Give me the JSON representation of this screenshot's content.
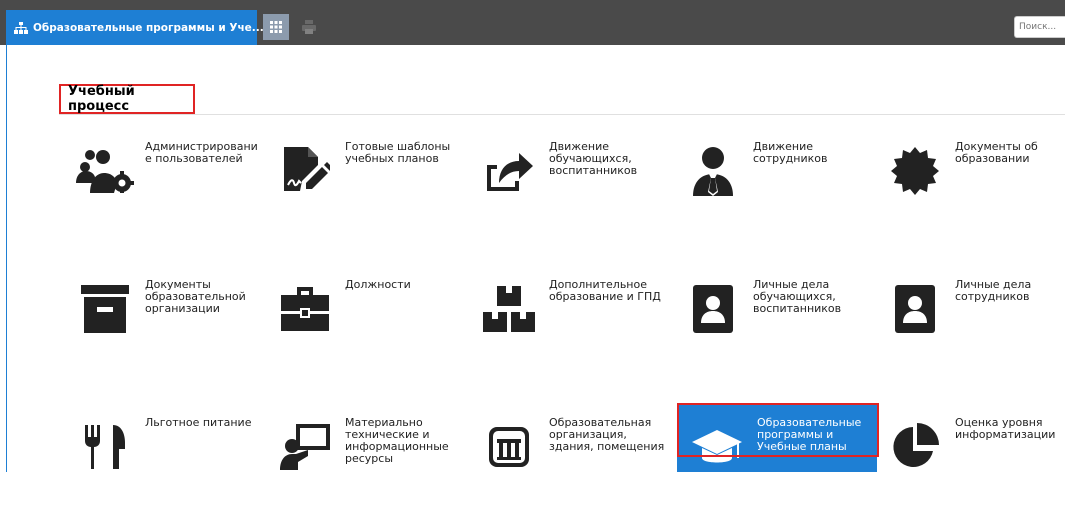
{
  "topbar": {
    "active_tab": "Образовательные программы и Уче...",
    "search_placeholder": "Поиск..."
  },
  "section": {
    "title": "Учебный процесс"
  },
  "tiles": [
    {
      "label": "Администрировани е пользователей",
      "icon": "users-gear-icon"
    },
    {
      "label": "Готовые шаблоны учебных планов",
      "icon": "signed-document-icon"
    },
    {
      "label": "Движение обучающихся, воспитанников",
      "icon": "share-arrow-icon"
    },
    {
      "label": "Движение сотрудников",
      "icon": "employee-icon"
    },
    {
      "label": "Документы об образовании",
      "icon": "certificate-seal-icon"
    },
    {
      "label": "Документы образовательной организации",
      "icon": "archive-box-icon"
    },
    {
      "label": "Должности",
      "icon": "briefcase-icon"
    },
    {
      "label": "Дополнительное образование и ГПД",
      "icon": "blocks-icon"
    },
    {
      "label": "Личные дела обучающихся, воспитанников",
      "icon": "id-badge-icon"
    },
    {
      "label": "Личные дела сотрудников",
      "icon": "id-badge-icon"
    },
    {
      "label": "Льготное питание",
      "icon": "utensils-icon"
    },
    {
      "label": "Материально технические и информационные ресурсы",
      "icon": "presenter-board-icon"
    },
    {
      "label": "Образовательная организация, здания, помещения",
      "icon": "building-icon"
    },
    {
      "label": "Образовательные программы и Учебные планы",
      "icon": "graduation-cap-icon"
    },
    {
      "label": "Оценка уровня информатизации",
      "icon": "pie-chart-icon"
    }
  ],
  "colors": {
    "accent": "#1e7fd4",
    "highlight": "#e02424",
    "topbar": "#4a4a4a"
  }
}
